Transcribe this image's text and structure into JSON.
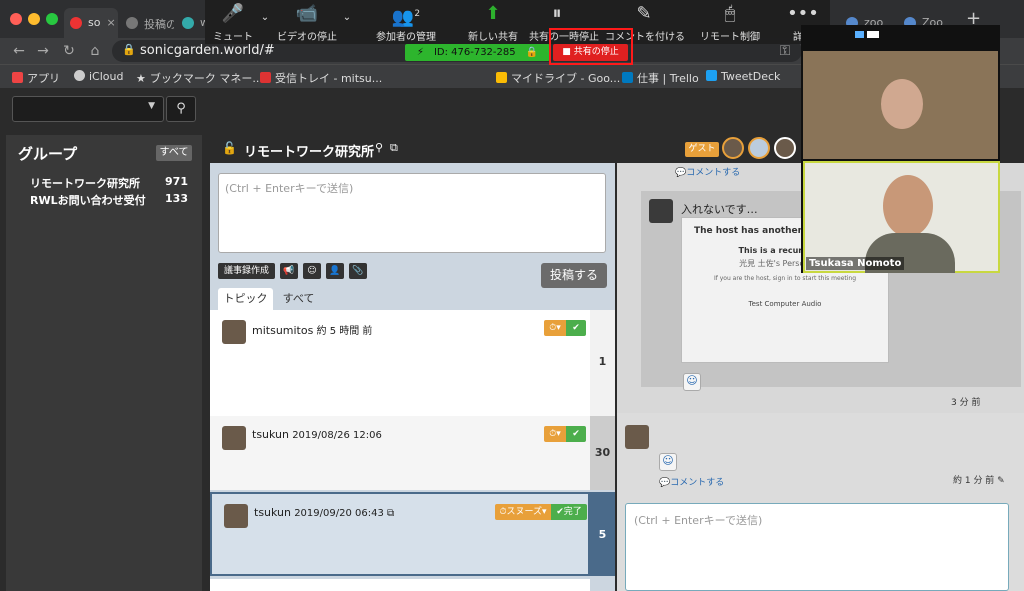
{
  "browser": {
    "tabs": [
      {
        "label": "so",
        "active": true
      },
      {
        "label": "投稿の",
        "active": false
      },
      {
        "label": "w",
        "active": false
      },
      {
        "label": "zoo",
        "active": false
      },
      {
        "label": "Zoo",
        "active": false
      }
    ],
    "new_tab": "+",
    "url": "sonicgarden.world/#",
    "bookmarks": [
      "アプリ",
      "iCloud",
      "ブックマーク マネー...",
      "受信トレイ - mitsu...",
      "マイドライブ - Goo...",
      "仕事 | Trello",
      "TweetDeck"
    ]
  },
  "zoom": {
    "toolbar": [
      "ミュート",
      "ビデオの停止",
      "参加者の管理",
      "新しい共有",
      "共有の一時停止",
      "コメントを付ける",
      "リモート制御",
      "詳細"
    ],
    "participants_count": "2",
    "meeting_id": "ID: 476-732-285",
    "stop_share": "共有の停止",
    "video_name": "Tsukasa Nomoto"
  },
  "sidebar": {
    "title": "グループ",
    "all_label": "すべて",
    "groups": [
      {
        "name": "リモートワーク研究所",
        "count": "971"
      },
      {
        "name": "RWLお問い合わせ受付",
        "count": "133"
      }
    ]
  },
  "header": {
    "title": "リモートワーク研究所",
    "guest": "ゲスト"
  },
  "compose": {
    "placeholder": "(Ctrl + Enterキーで送信)",
    "minutes_btn": "議事録作成",
    "post_btn": "投稿する",
    "tab_topic": "トピック",
    "tab_all": "すべて"
  },
  "topics": [
    {
      "user": "mitsumitos",
      "time": "約 5 時間 前",
      "count": "1"
    },
    {
      "user": "tsukun",
      "time": "2019/08/26 12:06",
      "count": "30"
    },
    {
      "user": "tsukun",
      "time": "2019/09/20 06:43",
      "count": "5",
      "snooze": "スヌーズ",
      "done": "完了"
    }
  ],
  "thread": {
    "comment": "コメントする",
    "msg": "入れないです…",
    "shot_title": "The host has another me",
    "shot_line1": "This is a recurring m",
    "shot_line2": "光見 土佐's Personal Me",
    "shot_line3": "If you are the host, sign in to start this meeting",
    "shot_btn": "Test Computer Audio",
    "time1": "3 分 前",
    "time2": "約 1 分 前",
    "reply_placeholder": "(Ctrl + Enterキーで送信)"
  }
}
